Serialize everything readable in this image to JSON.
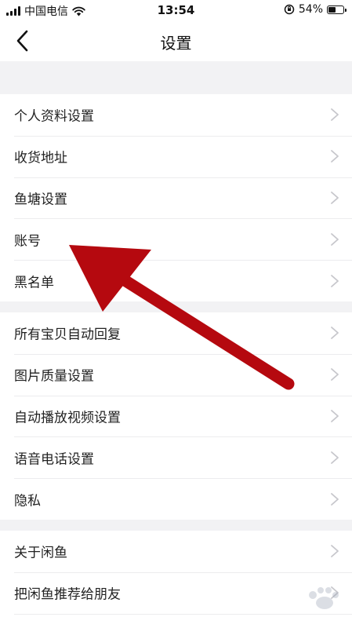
{
  "status_bar": {
    "carrier": "中国电信",
    "time": "13:54",
    "battery_percent": "54%",
    "battery_level": 0.54
  },
  "nav": {
    "title": "设置",
    "back_icon": "chevron-left-icon"
  },
  "groups": [
    {
      "items": [
        {
          "label": "个人资料设置"
        },
        {
          "label": "收货地址"
        },
        {
          "label": "鱼塘设置"
        },
        {
          "label": "账号"
        },
        {
          "label": "黑名单"
        }
      ]
    },
    {
      "items": [
        {
          "label": "所有宝贝自动回复"
        },
        {
          "label": "图片质量设置"
        },
        {
          "label": "自动播放视频设置"
        },
        {
          "label": "语音电话设置"
        },
        {
          "label": "隐私"
        }
      ]
    },
    {
      "items": [
        {
          "label": "关于闲鱼"
        },
        {
          "label": "把闲鱼推荐给朋友"
        },
        {
          "label": ""
        }
      ]
    }
  ],
  "annotation": {
    "arrow_color": "#b5090f",
    "points_to": "账号"
  },
  "colors": {
    "background": "#f2f2f4",
    "row_background": "#ffffff",
    "chevron": "#c7c7cc"
  }
}
